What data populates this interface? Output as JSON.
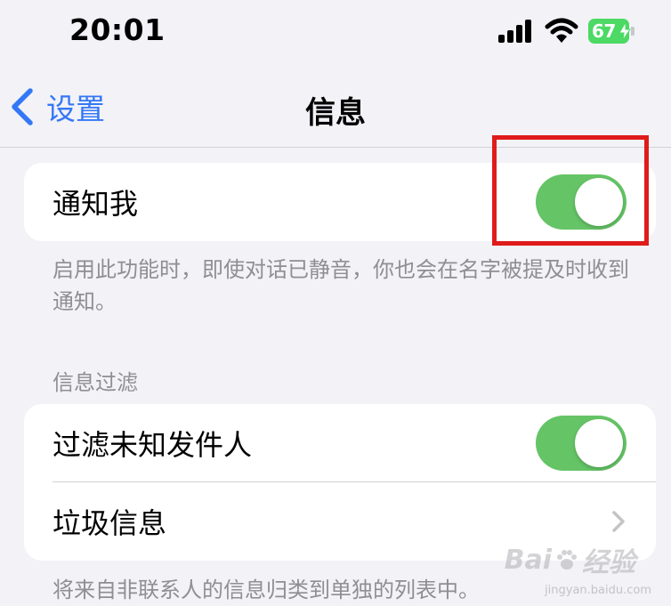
{
  "status_bar": {
    "time": "20:01",
    "battery_level": "67",
    "icons": [
      "signal-icon",
      "wifi-icon",
      "battery-icon",
      "charging-bolt-icon"
    ]
  },
  "nav": {
    "back_label": "设置",
    "title": "信息"
  },
  "mention_section": {
    "notify_label": "通知我",
    "notify_enabled": true,
    "footer": "启用此功能时，即使对话已静音，你也会在名字被提及时收到通知。"
  },
  "filter_section": {
    "header": "信息过滤",
    "filter_unknown_label": "过滤未知发件人",
    "filter_unknown_enabled": true,
    "junk_label": "垃圾信息",
    "footer": "将来自非联系人的信息归类到单独的列表中。"
  },
  "watermark": {
    "text_left": "Bai",
    "text_right": "经验",
    "sub": "jingyan.baidu.com"
  },
  "colors": {
    "accent": "#3478f6",
    "toggle_on": "#65c466",
    "background": "#f2f2f7",
    "highlight": "#e01b1b"
  }
}
